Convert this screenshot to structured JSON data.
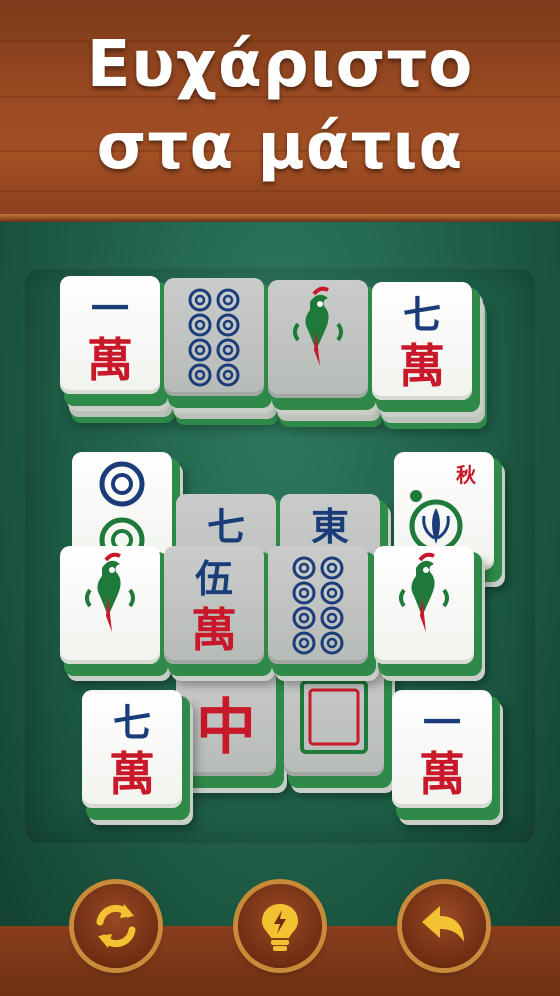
{
  "banner": {
    "line1": "Ευχάριστο",
    "line2": "στα μάτια"
  },
  "tiles": [
    {
      "id": "t1",
      "kind": "char",
      "num": "一",
      "dim": false
    },
    {
      "id": "t2",
      "kind": "dots8",
      "dim": true
    },
    {
      "id": "t3",
      "kind": "bird",
      "dim": true
    },
    {
      "id": "t4",
      "kind": "char",
      "num": "七",
      "dim": false
    },
    {
      "id": "t5",
      "kind": "dots2",
      "dim": false
    },
    {
      "id": "t6",
      "kind": "char",
      "num": "七",
      "dim": true
    },
    {
      "id": "t7",
      "kind": "char",
      "num": "東",
      "dim": true
    },
    {
      "id": "t8",
      "kind": "flower",
      "mark": "秋",
      "dim": false
    },
    {
      "id": "t9",
      "kind": "bird",
      "dim": false
    },
    {
      "id": "t10",
      "kind": "char",
      "num": "伍",
      "dim": true
    },
    {
      "id": "t11",
      "kind": "dots8",
      "dim": true
    },
    {
      "id": "t12",
      "kind": "bird",
      "dim": false
    },
    {
      "id": "t13",
      "kind": "red",
      "dim": true
    },
    {
      "id": "t14",
      "kind": "white",
      "dim": true
    },
    {
      "id": "t15",
      "kind": "char",
      "num": "七",
      "dim": false
    },
    {
      "id": "t16",
      "kind": "char",
      "num": "一",
      "dim": false
    }
  ],
  "wan": "萬",
  "buttons": [
    {
      "id": "shuffle",
      "icon": "shuffle-icon"
    },
    {
      "id": "hint",
      "icon": "lightbulb-icon"
    },
    {
      "id": "undo",
      "icon": "undo-icon"
    }
  ],
  "colors": {
    "blue": "#1a3d7a",
    "red": "#c8182a",
    "green": "#1e7a3a",
    "gold": "#f3c232"
  }
}
